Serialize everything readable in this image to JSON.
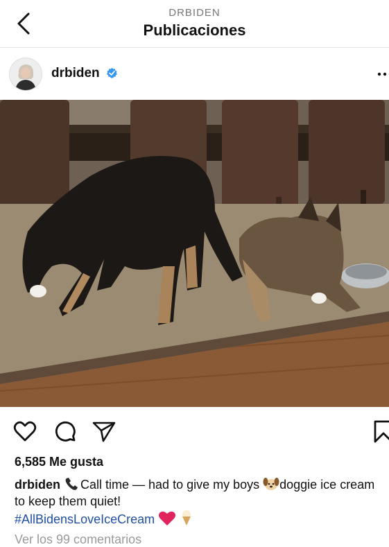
{
  "header": {
    "subtitle": "DRBIDEN",
    "title": "Publicaciones",
    "back_icon": "chevron-left-icon"
  },
  "post": {
    "username": "drbiden",
    "verified_icon": "verified-badge-icon",
    "more_icon": "more-horizontal-icon",
    "photo_description_icons": [
      "dog",
      "dog"
    ]
  },
  "actions": {
    "like_icon": "heart-outline-icon",
    "comment_icon": "comment-bubble-icon",
    "share_icon": "paper-plane-icon",
    "save_icon": "bookmark-icon"
  },
  "likes": "6,585 Me gusta",
  "caption": {
    "username": "drbiden",
    "text_part1": "Call time — had to give my boys ",
    "text_part2": "doggie ice cream to keep them quiet!",
    "hashtag": "#AllBidensLoveIceCream",
    "emojis": [
      "telephone-icon",
      "dog-face-icon",
      "red-heart-icon",
      "ice-cream-cone-icon"
    ]
  },
  "comments_link": "Ver los 99 comentarios",
  "colors": {
    "hashtag": "#1f4fa0",
    "verified": "#3897f0",
    "heart": "#e0245e"
  }
}
